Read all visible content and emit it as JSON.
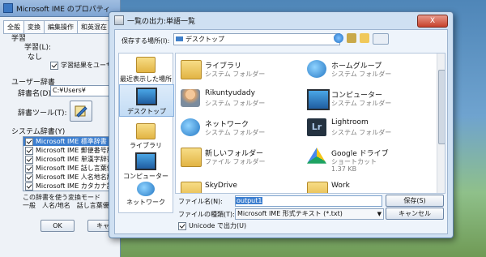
{
  "bg_dialog": {
    "title": "Microsoft IME のプロパティ",
    "tabs": [
      "全般",
      "変換",
      "編集操作",
      "和英混在"
    ],
    "learn_section": "学習",
    "learn_label": "学習(L):",
    "learn_value": "なし",
    "learn_check": "学習結果をユーザー",
    "user_dict_section": "ユーザー辞書",
    "dict_name_label": "辞書名(D):",
    "dict_name_value": "C:¥Users¥",
    "dict_tool_label": "辞書ツール(T):",
    "system_dict_section": "システム辞書(Y)",
    "system_dicts": [
      {
        "label": "Microsoft IME 標準辞書",
        "checked": true,
        "selected": true
      },
      {
        "label": "Microsoft IME 郵便番号辞書",
        "checked": true,
        "selected": false
      },
      {
        "label": "Microsoft IME 単漢字辞書",
        "checked": true,
        "selected": false
      },
      {
        "label": "Microsoft IME 話し言葉例文",
        "checked": true,
        "selected": false
      },
      {
        "label": "Microsoft IME 人名地名辞書",
        "checked": true,
        "selected": false
      },
      {
        "label": "Microsoft IME カタカナ語英語",
        "checked": true,
        "selected": false
      }
    ],
    "mode_section": "この辞書を使う変換モード",
    "mode_text": "一般　人名/地名　話し言葉優先",
    "ok_label": "OK",
    "cancel_label": "キャ"
  },
  "dialog": {
    "title": "一覧の出力:単語一覧",
    "close_label": "X",
    "location_label": "保存する場所(I):",
    "location_value": "デスクトップ",
    "places": [
      {
        "label": "最近表示した場所",
        "icon": "recent-places-icon"
      },
      {
        "label": "デスクトップ",
        "icon": "desktop-icon",
        "selected": true
      },
      {
        "label": "ライブラリ",
        "icon": "libraries-icon"
      },
      {
        "label": "コンピューター",
        "icon": "computer-icon"
      },
      {
        "label": "ネットワーク",
        "icon": "network-icon"
      }
    ],
    "files": [
      {
        "name": "ライブラリ",
        "type": "システム フォルダー",
        "icon": "libraries-icon"
      },
      {
        "name": "ホームグループ",
        "type": "システム フォルダー",
        "icon": "homegroup-icon"
      },
      {
        "name": "Rikuntyudady",
        "type": "システム フォルダー",
        "icon": "user-folder-icon"
      },
      {
        "name": "コンピューター",
        "type": "システム フォルダー",
        "icon": "computer-icon"
      },
      {
        "name": "ネットワーク",
        "type": "システム フォルダー",
        "icon": "network-icon"
      },
      {
        "name": "Lightroom",
        "type": "システム フォルダー",
        "icon": "lightroom-icon"
      },
      {
        "name": "新しいフォルダー",
        "type": "ファイル フォルダー",
        "icon": "folder-icon"
      },
      {
        "name": "Google ドライブ",
        "type": "ショートカット",
        "size": "1.37 KB",
        "icon": "google-drive-icon"
      },
      {
        "name": "SkyDrive",
        "type": "",
        "icon": "folder-icon"
      },
      {
        "name": "Work",
        "type": "",
        "icon": "folder-icon"
      }
    ],
    "filename_label": "ファイル名(N):",
    "filename_value": "output1",
    "filetype_label": "ファイルの種類(T):",
    "filetype_value": "Microsoft IME 形式テキスト (*.txt)",
    "unicode_label": "Unicode で出力(U)",
    "unicode_checked": true,
    "save_label": "保存(S)",
    "cancel_label": "キャンセル"
  }
}
